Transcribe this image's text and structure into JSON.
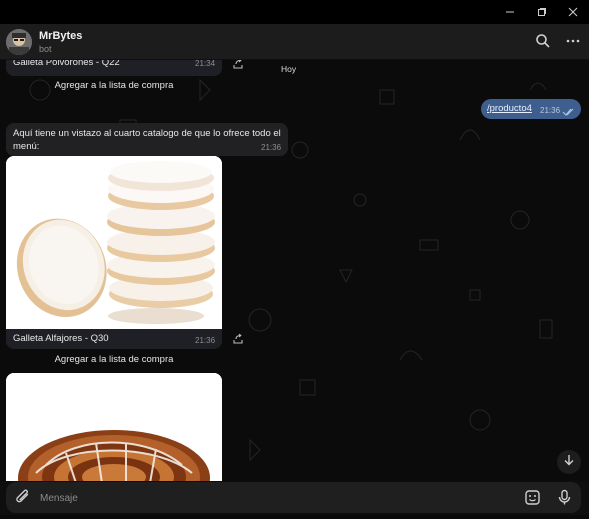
{
  "window": {
    "controls": {
      "minimize_icon": "minimize-icon",
      "restore_icon": "restore-icon",
      "close_icon": "close-icon"
    }
  },
  "header": {
    "name": "MrBytes",
    "subtitle": "bot",
    "icons": [
      "search-icon",
      "more-vertical-icon"
    ]
  },
  "chat": {
    "date_chip": "Hoy",
    "messages": [
      {
        "type": "photo_caption",
        "caption": "Galleta Polvorones - Q22",
        "time": "21:34",
        "button_label": "Agregar a la lista de compra"
      },
      {
        "type": "outgoing_command",
        "text": "/producto4",
        "time": "21:36"
      },
      {
        "type": "incoming_text",
        "text": "Aquí tiene un vistazo al cuarto catalogo de que lo ofrece todo el menú:",
        "time": "21:36"
      },
      {
        "type": "photo_caption",
        "caption": "Galleta Alfajores - Q30",
        "time": "21:36",
        "button_label": "Agregar a la lista de compra"
      }
    ]
  },
  "composer": {
    "placeholder": "Mensaje",
    "icons": [
      "attach-icon",
      "sticker-icon",
      "microphone-icon"
    ]
  },
  "colors": {
    "background": "#0b0b0b",
    "incoming_bubble": "#212124",
    "outgoing_bubble": "#3e5f8e",
    "header": "#1c1c1d"
  }
}
